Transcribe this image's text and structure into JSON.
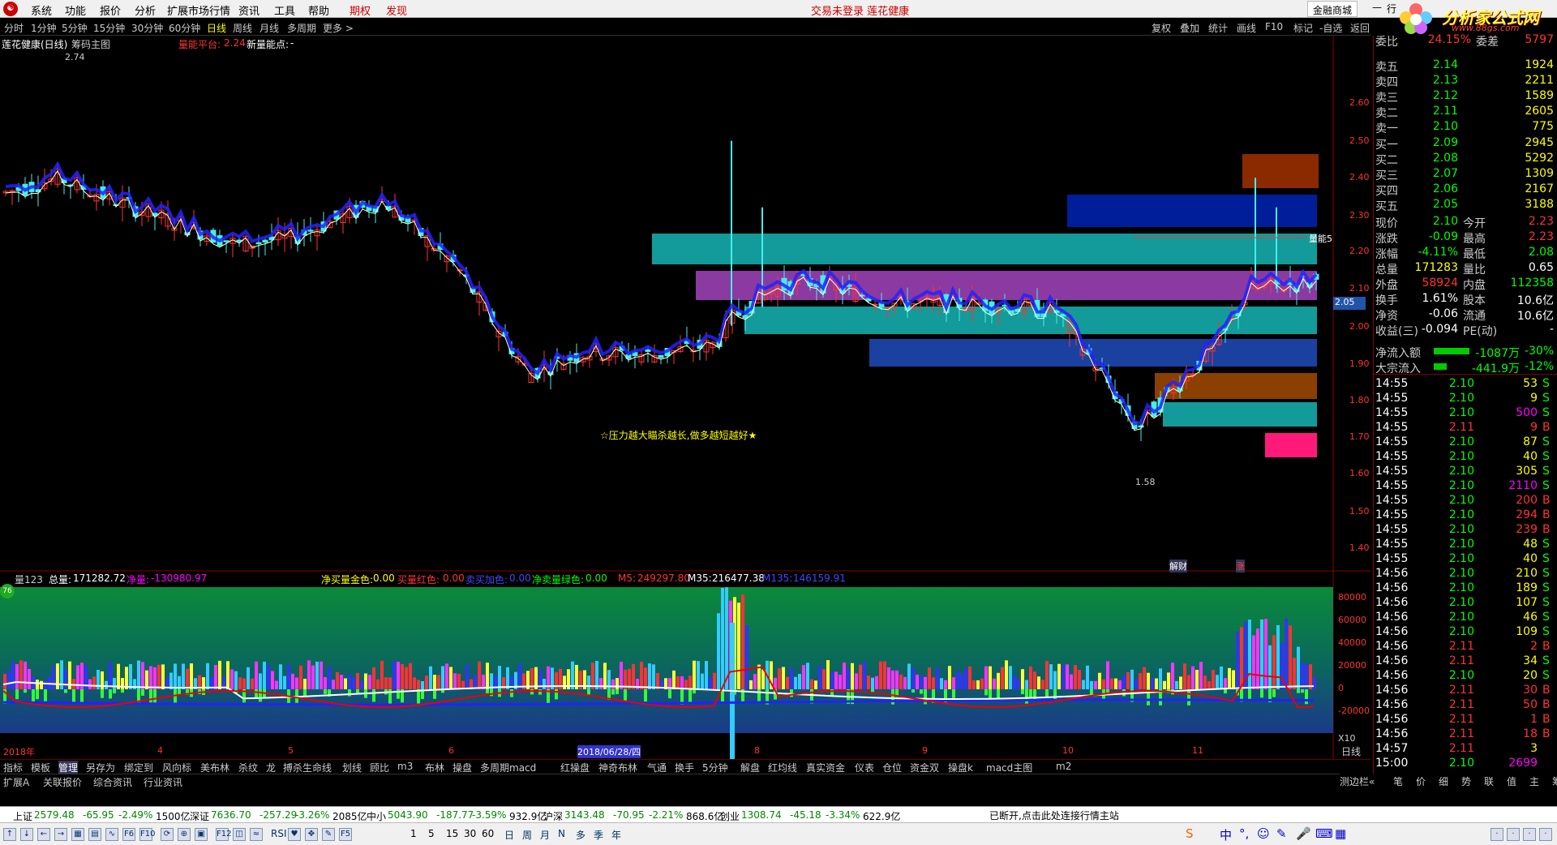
{
  "menu": {
    "items": [
      "系统",
      "功能",
      "报价",
      "分析",
      "扩展市场行情",
      "资讯",
      "工具",
      "帮助",
      "期权",
      "发现"
    ],
    "title_center": "交易未登录  莲花健康",
    "mall": "金融商城",
    "cut": "行"
  },
  "brand": {
    "name": "分析家公式网",
    "url": "www.88gs.com"
  },
  "periods": [
    "分时",
    "1分钟",
    "5分钟",
    "15分钟",
    "30分钟",
    "60分钟",
    "日线",
    "周线",
    "月线",
    "多周期",
    "更多 >"
  ],
  "active_period": "日线",
  "right_tools": [
    "复权",
    "叠加",
    "统计",
    "画线",
    "F10",
    "标记",
    "-自选",
    "返回"
  ],
  "chart": {
    "stock_title": "莲花健康(日线)",
    "chip_label": "筹码主图",
    "energy_label": "量能平台:",
    "energy_value": "2.24",
    "new_energy_label": "新量能点:",
    "new_energy_value": "-",
    "high_label": "2.74",
    "low_label": "1.58",
    "slogan": "☆压力越大瞄杀越长,做多越短越好★",
    "energy_marker": "量能5",
    "current_price_tag": "2.05",
    "event_label_1": "解财",
    "event_label_2": "涨",
    "y_ticks": [
      "2.60",
      "2.50",
      "2.40",
      "2.30",
      "2.20",
      "2.10",
      "2.00",
      "1.90",
      "1.80",
      "1.70",
      "1.60",
      "1.50",
      "1.40"
    ],
    "volume_header": {
      "name": "量123",
      "total_label": "总量:",
      "total": "171282.72",
      "net_label": "净量:",
      "net": "-130980.97",
      "gold_label": "净买量金色:",
      "gold": "0.00",
      "red_label": "买量红色:",
      "red": "0.00",
      "blue_label": "卖买加色:",
      "blue": "0.00",
      "green_label": "净卖量绿色:",
      "green": "0.00",
      "m5_label": "M5:",
      "m5": "249297.80",
      "m35_label": "M35:",
      "m35": "216477.38",
      "m135_label": "M135:",
      "m135": "146159.91"
    },
    "vol_ticks": [
      "80000",
      "60000",
      "40000",
      "20000",
      "0",
      "-20000"
    ],
    "vol_unit": "X10",
    "vol_badge": "76",
    "x_labels": [
      "2018年",
      "4",
      "5",
      "6",
      "2018/06/28/四",
      "8",
      "9",
      "10",
      "11"
    ],
    "x_right": "日线"
  },
  "quote": {
    "weibi_label": "委比",
    "weibi": "24.15%",
    "weicha_label": "委差",
    "weicha": "5797",
    "asks": [
      {
        "label": "卖五",
        "price": "2.14",
        "vol": "1924"
      },
      {
        "label": "卖四",
        "price": "2.13",
        "vol": "2211"
      },
      {
        "label": "卖三",
        "price": "2.12",
        "vol": "1589"
      },
      {
        "label": "卖二",
        "price": "2.11",
        "vol": "2605"
      },
      {
        "label": "卖一",
        "price": "2.10",
        "vol": "775"
      }
    ],
    "bids": [
      {
        "label": "买一",
        "price": "2.09",
        "vol": "2945"
      },
      {
        "label": "买二",
        "price": "2.08",
        "vol": "5292"
      },
      {
        "label": "买三",
        "price": "2.07",
        "vol": "1309"
      },
      {
        "label": "买四",
        "price": "2.06",
        "vol": "2167"
      },
      {
        "label": "买五",
        "price": "2.05",
        "vol": "3188"
      }
    ],
    "stats": [
      {
        "l1": "现价",
        "v1": "2.10",
        "l2": "今开",
        "v2": "2.23"
      },
      {
        "l1": "涨跌",
        "v1": "-0.09",
        "l2": "最高",
        "v2": "2.23"
      },
      {
        "l1": "涨幅",
        "v1": "-4.11%",
        "l2": "最低",
        "v2": "2.08"
      },
      {
        "l1": "总量",
        "v1": "171283",
        "l2": "量比",
        "v2": "0.65"
      },
      {
        "l1": "外盘",
        "v1": "58924",
        "l2": "内盘",
        "v2": "112358"
      },
      {
        "l1": "换手",
        "v1": "1.61%",
        "l2": "股本",
        "v2": "10.6亿"
      },
      {
        "l1": "净资",
        "v1": "-0.06",
        "l2": "流通",
        "v2": "10.6亿"
      },
      {
        "l1": "收益(三)",
        "v1": "-0.094",
        "l2": "PE(动)",
        "v2": "-"
      }
    ],
    "flow": [
      {
        "label": "净流入额",
        "value": "-1087万",
        "pct": "-30%"
      },
      {
        "label": "大宗流入",
        "value": "-441.9万",
        "pct": "-12%"
      }
    ],
    "ticks": [
      {
        "t": "14:55",
        "p": "2.10",
        "v": "53",
        "s": "S"
      },
      {
        "t": "14:55",
        "p": "2.10",
        "v": "9",
        "s": "S"
      },
      {
        "t": "14:55",
        "p": "2.10",
        "v": "500",
        "s": "S"
      },
      {
        "t": "14:55",
        "p": "2.11",
        "v": "9",
        "s": "B"
      },
      {
        "t": "14:55",
        "p": "2.10",
        "v": "87",
        "s": "S"
      },
      {
        "t": "14:55",
        "p": "2.10",
        "v": "40",
        "s": "S"
      },
      {
        "t": "14:55",
        "p": "2.10",
        "v": "305",
        "s": "S"
      },
      {
        "t": "14:55",
        "p": "2.10",
        "v": "2110",
        "s": "S"
      },
      {
        "t": "14:55",
        "p": "2.10",
        "v": "200",
        "s": "B"
      },
      {
        "t": "14:55",
        "p": "2.10",
        "v": "294",
        "s": "B"
      },
      {
        "t": "14:55",
        "p": "2.10",
        "v": "239",
        "s": "B"
      },
      {
        "t": "14:55",
        "p": "2.10",
        "v": "48",
        "s": "S"
      },
      {
        "t": "14:55",
        "p": "2.10",
        "v": "40",
        "s": "S"
      },
      {
        "t": "14:56",
        "p": "2.10",
        "v": "210",
        "s": "S"
      },
      {
        "t": "14:56",
        "p": "2.10",
        "v": "189",
        "s": "S"
      },
      {
        "t": "14:56",
        "p": "2.10",
        "v": "107",
        "s": "S"
      },
      {
        "t": "14:56",
        "p": "2.10",
        "v": "46",
        "s": "S"
      },
      {
        "t": "14:56",
        "p": "2.10",
        "v": "109",
        "s": "S"
      },
      {
        "t": "14:56",
        "p": "2.11",
        "v": "2",
        "s": "B"
      },
      {
        "t": "14:56",
        "p": "2.11",
        "v": "34",
        "s": "S"
      },
      {
        "t": "14:56",
        "p": "2.10",
        "v": "20",
        "s": "S"
      },
      {
        "t": "14:56",
        "p": "2.11",
        "v": "30",
        "s": "B"
      },
      {
        "t": "14:56",
        "p": "2.11",
        "v": "50",
        "s": "B"
      },
      {
        "t": "14:56",
        "p": "2.11",
        "v": "1",
        "s": "B"
      },
      {
        "t": "14:56",
        "p": "2.11",
        "v": "18",
        "s": "B"
      },
      {
        "t": "14:57",
        "p": "2.11",
        "v": "3",
        "s": ""
      },
      {
        "t": "15:00",
        "p": "2.10",
        "v": "2699",
        "s": ""
      }
    ]
  },
  "tabs_row1": [
    "指标",
    "模板",
    "管理",
    "另存为",
    "绑定到",
    "风向标",
    "美布林",
    "杀纹",
    "龙",
    "搏杀生命线",
    "划线",
    "顾比",
    "m3",
    "布林",
    "操盘",
    "多周期macd",
    "红操盘",
    "神奇布林",
    "气通",
    "换手",
    "5分钟",
    "解盘",
    "红均线",
    "真实资金",
    "仪表",
    "仓位",
    "资金双",
    "操盘k",
    "macd主图",
    "m2"
  ],
  "tabs_row1_active": "管理",
  "tabs_row2": [
    "扩展A",
    "关联报价",
    "综合资讯",
    "行业资讯"
  ],
  "tabs_right": [
    "测边栏«",
    "笔",
    "价",
    "细",
    "势",
    "联",
    "值",
    "主",
    "筹"
  ],
  "index_bar": {
    "items": [
      {
        "name": "上证",
        "price": "2579.48",
        "chg": "-65.95",
        "pct": "-2.49%",
        "amt": "1500亿"
      },
      {
        "name": "深证",
        "price": "7636.70",
        "chg": "-257.29",
        "pct": "-3.26%",
        "amt": "2085亿"
      },
      {
        "name": "中小",
        "price": "5043.90",
        "chg": "-187.77",
        "pct": "-3.59%",
        "amt": "932.9亿"
      },
      {
        "name": "沪深",
        "price": "3143.48",
        "chg": "-70.95",
        "pct": "-2.21%",
        "amt": "868.6亿"
      },
      {
        "name": "创业",
        "price": "1308.74",
        "chg": "-45.18",
        "pct": "-3.34%",
        "amt": "622.9亿"
      }
    ],
    "status": "已断开,点击此处连接行情主站"
  },
  "toolbar": {
    "nums": [
      "1",
      "5",
      "15",
      "30",
      "60"
    ],
    "cals": [
      "日",
      "周",
      "月",
      "N",
      "多",
      "季",
      "年"
    ],
    "rsi": "RSI"
  }
}
